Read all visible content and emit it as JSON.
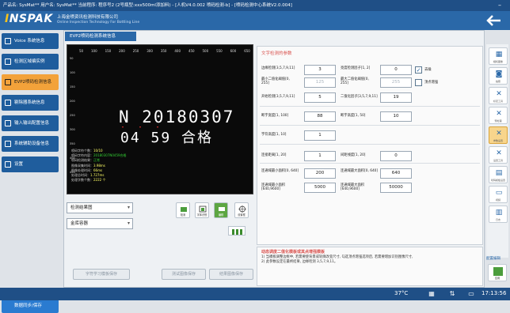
{
  "titlebar": {
    "text": "产品名: SysMat**  用户名: SysMat**  当前程序: 程序号2 (2号瓶型:xxx500ml添加料) - [人机V4.0.002 喷码检测-b] - [喷码检测中心系统V2.0.004]"
  },
  "header": {
    "logo_main": "INSPAK",
    "company_cn": "上海金喷资讯检测科技有限公司",
    "company_en": "Online Inspection Technology For Bottling Line"
  },
  "leftnav": {
    "items": [
      {
        "label": "Voice 系统信息",
        "active": false
      },
      {
        "label": "检测区域编实例",
        "active": false
      },
      {
        "label": "EVP2喷码检测信息",
        "active": true
      },
      {
        "label": "剔除器系统信息",
        "active": false
      },
      {
        "label": "输入输出配置信息",
        "active": false
      },
      {
        "label": "系统辅助设备信息",
        "active": false
      },
      {
        "label": "设置",
        "active": false
      }
    ],
    "sync_button": "数据同步/保存"
  },
  "panel": {
    "tab_title": "EVP2喷码检测系统信息"
  },
  "camera": {
    "ruler_top": [
      "50",
      "100",
      "150",
      "200",
      "250",
      "300",
      "350",
      "400",
      "450",
      "500",
      "550",
      "600",
      "650"
    ],
    "ruler_left": [
      "50",
      "100",
      "150",
      "200",
      "250",
      "300",
      "350",
      "400",
      "450"
    ],
    "ocr_line1": "N 20180307",
    "ocr_line2": "04 59 合格",
    "info": [
      {
        "label": "喷码字符个数：",
        "value": "10/10"
      },
      {
        "label": "喷码字符内容：",
        "value": "20180307N0459合格"
      },
      {
        "label": "喷码检测结果：",
        "value": "正常"
      },
      {
        "label": "图像采集时间：",
        "value": "3.98ms"
      },
      {
        "label": "图像处理时间：",
        "value": "66ms"
      },
      {
        "label": "处理总时间：",
        "value": "1.727ms"
      },
      {
        "label": "处理字数个数：",
        "value": "2222 个"
      }
    ]
  },
  "dropdowns": {
    "area": "检测结果图",
    "type": "金库容器"
  },
  "tools": [
    {
      "label": "检测",
      "selected": false
    },
    {
      "label": "字体识别",
      "selected": false
    },
    {
      "label": "编辑",
      "selected": true
    },
    {
      "label": "设置框",
      "selected": false
    }
  ],
  "bottom_buttons": {
    "save_template": "字符学习模板保存",
    "test_image": "测试图像保存",
    "output_image": "结果图像保存"
  },
  "params": {
    "title": "文字检测的参数",
    "rows": [
      {
        "label": "边缘检测[3,5,7,9,11]",
        "value": "3"
      },
      {
        "label": "最小二值化阈值[0, 255]",
        "value": "125"
      },
      {
        "label": "开始检测[3,5,7,9,11]",
        "value": "5"
      },
      {
        "label": "断字宽度[1, 100]",
        "value": "88"
      },
      {
        "label": "字符高度[1, 10]",
        "value": "1"
      },
      {
        "label": "连接距离[1, 20]",
        "value": "1"
      },
      {
        "label": "连通域最小面积[0, 640]",
        "value": "200"
      },
      {
        "label": "连通域最小面积[640,9600]",
        "value": "5000"
      }
    ],
    "rows_right": [
      {
        "label": "亮度检测因子[1, 2]",
        "value": "0"
      },
      {
        "label": "最大二值化阈值[0, 255]",
        "value": "255"
      },
      {
        "label": "二值化因子[3,5,7,9,11]",
        "value": "19"
      },
      {
        "label": "断字高度[1, 50]",
        "value": "10"
      },
      {
        "label": "间距线度[1, 20]",
        "value": "0"
      },
      {
        "label": "连通域最大面积[0, 640]",
        "value": "640"
      },
      {
        "label": "连通域最大面积[640,9600]",
        "value": "50000"
      }
    ],
    "checks": [
      {
        "label": "去噪",
        "checked": true
      },
      {
        "label": "顶点增强",
        "checked": false
      }
    ]
  },
  "hint": {
    "title": "动态调度二值化模板或其点增强模板",
    "text": "1) 当模板调整边框中, 若需要使背景或轮廓改变尺寸, 勾选顶点增强选项后, 若需要增加识别图像尺寸,\n2) 此参数设定在最终结果, 边缘检测 3,5,7,9,11。"
  },
  "righttools": [
    {
      "label": "相机图像",
      "icon": "camera-grid-icon",
      "active": false
    },
    {
      "label": "拍照",
      "icon": "camera-icon",
      "active": false
    },
    {
      "label": "标定工具",
      "icon": "wrench-icon",
      "active": false
    },
    {
      "label": "预处理",
      "icon": "wrench-icon",
      "active": false
    },
    {
      "label": "参数设置",
      "icon": "tools-icon",
      "active": true
    },
    {
      "label": "设置工具",
      "icon": "wrench-icon",
      "active": false
    },
    {
      "label": "喷码模板设置",
      "icon": "chip-icon",
      "active": false
    },
    {
      "label": "视频",
      "icon": "monitor-icon",
      "active": false
    },
    {
      "label": "日志",
      "icon": "calendar-icon",
      "active": false
    }
  ],
  "apply": {
    "caption": "配置编辑",
    "label": "应用"
  },
  "taskbar": {
    "temperature": "37°C",
    "time": "17:13:56"
  }
}
